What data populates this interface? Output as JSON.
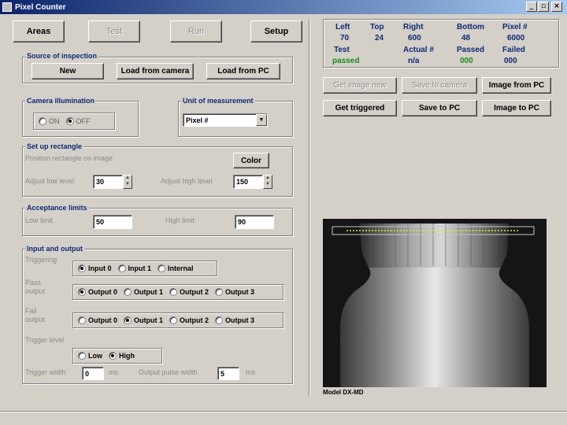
{
  "window": {
    "title": "Pixel Counter",
    "controls": [
      "_",
      "▫",
      "×"
    ]
  },
  "toolbar": {
    "areas": "Areas",
    "test": "Test",
    "run": "Run",
    "setup": "Setup"
  },
  "source": {
    "title": "Source of inspection",
    "new": "New",
    "load_camera": "Load from camera",
    "load_pc": "Load from PC"
  },
  "illumination": {
    "title": "Camera illumination",
    "on": "ON",
    "off": "OFF"
  },
  "unit": {
    "title": "Unit of measurement",
    "value": "Pixel #"
  },
  "rect": {
    "title": "Set up rectangle",
    "position_label": "Position rectangle on image",
    "color": "Color",
    "low_label": "Adjust low level",
    "low_value": "30",
    "high_label": "Adjust high level",
    "high_value": "150"
  },
  "acceptance": {
    "title": "Acceptance limits",
    "low_label": "Low limit",
    "low_value": "50",
    "high_label": "High limit",
    "high_value": "90"
  },
  "io": {
    "title": "Input and output",
    "triggering_label": "Triggering",
    "triggering": [
      "Input 0",
      "Input 1",
      "Internal"
    ],
    "pass_label": "Pass output",
    "fail_label": "Fail output",
    "outputs": [
      "Output 0",
      "Output 1",
      "Output 2",
      "Output 3"
    ],
    "trigger_level_label": "Trigger level",
    "low": "Low",
    "high": "High",
    "trigger_width_label": "Trigger width",
    "trigger_width_value": "0",
    "trigger_width_unit": "ms",
    "pulse_width_label": "Output pulse width",
    "pulse_width_value": "5",
    "pulse_width_unit": "ms"
  },
  "stats": {
    "left_h": "Left",
    "left_v": "70",
    "top_h": "Top",
    "top_v": "24",
    "right_h": "Right",
    "right_v": "600",
    "bottom_h": "Bottom",
    "bottom_v": "48",
    "pixel_h": "Pixel #",
    "pixel_v": "6000",
    "test_h": "Test",
    "test_v": "passed",
    "actual_h": "Actual #",
    "actual_v": "n/a",
    "passed_h": "Passed",
    "passed_v": "000",
    "failed_h": "Failed",
    "failed_v": "000"
  },
  "image_buttons": {
    "get_new": "Get image new",
    "save_camera": "Save to camera",
    "from_pc": "Image from PC",
    "get_triggered": "Get triggered",
    "save_pc": "Save to PC",
    "to_pc": "Image to PC"
  },
  "preview": {
    "caption": "Model DX-MD"
  },
  "colors": {
    "accent": "#0a246a",
    "text_blue": "#0a2a7a",
    "green": "#1a8a1a",
    "face": "#d4d0c8"
  }
}
